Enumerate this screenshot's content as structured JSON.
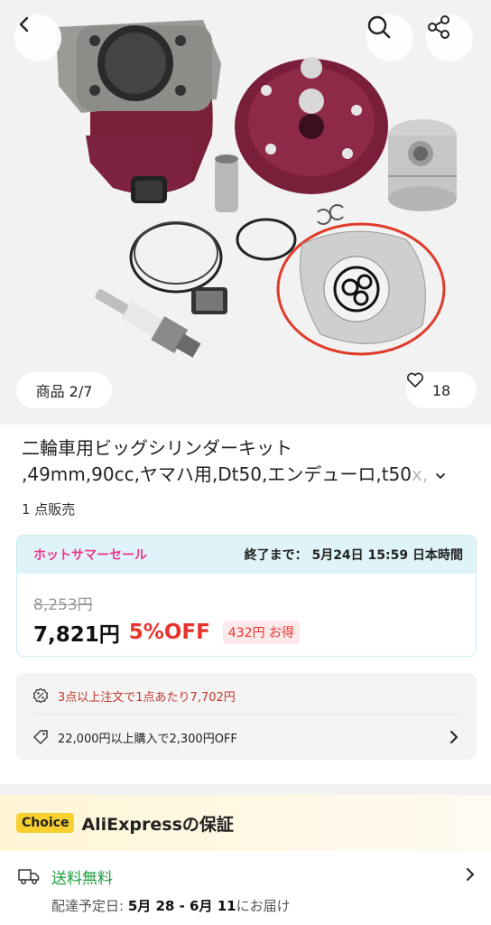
{
  "header": {
    "back_icon": "chevron-left-icon",
    "search_icon": "search-icon",
    "share_icon": "share-icon"
  },
  "gallery": {
    "counter": "商品 2/7",
    "wishlist_count": "18"
  },
  "product": {
    "title_line1": "二輪車用ビッグシリンダーキット",
    "title_line2": ",49mm,90cc,ヤマハ用,Dt50,エンデューロ,t50",
    "title_fade": "x,",
    "sold": "1 点販売"
  },
  "sale": {
    "tag": "ホットサマーセール",
    "ends": "終了まで： 5月24日 15:59 日本時間",
    "original_price": "8,253円",
    "price": "7,821円",
    "discount": "5%OFF",
    "savings": "432円 お得"
  },
  "coupons": {
    "bulk": "3点以上注文で1点あたり7,702円",
    "threshold": "22,000円以上購入で2,300円OFF"
  },
  "guarantee": {
    "badge": "Choice",
    "title": "AliExpressの保証"
  },
  "shipping": {
    "label": "送料無料",
    "date_prefix": "配達予定日: ",
    "date_range": "5月 28 - 6月 11",
    "date_suffix": "にお届け"
  },
  "colors": {
    "accent_pink": "#f0338b",
    "price_red": "#e8332d",
    "free_shipping_green": "#1a9e3d",
    "choice_yellow": "#f8d030",
    "sale_header_bg": "#dff4f8"
  }
}
